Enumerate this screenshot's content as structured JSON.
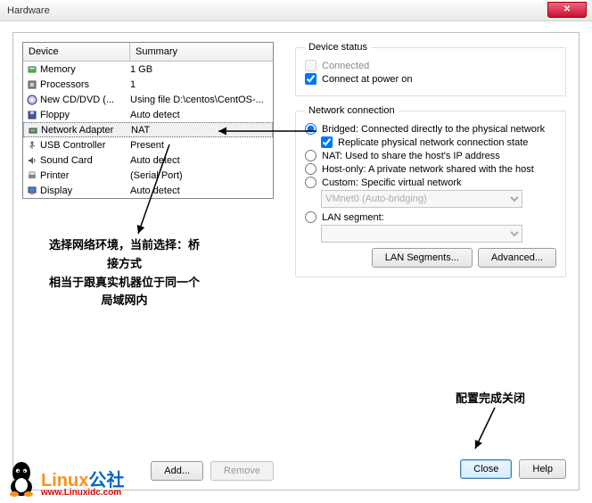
{
  "window": {
    "title": "Hardware"
  },
  "table": {
    "headers": {
      "device": "Device",
      "summary": "Summary"
    },
    "rows": [
      {
        "icon": "memory",
        "device": "Memory",
        "summary": "1 GB"
      },
      {
        "icon": "cpu",
        "device": "Processors",
        "summary": "1"
      },
      {
        "icon": "cd",
        "device": "New CD/DVD (...",
        "summary": "Using file D:\\centos\\CentOS-..."
      },
      {
        "icon": "floppy",
        "device": "Floppy",
        "summary": "Auto detect"
      },
      {
        "icon": "net",
        "device": "Network Adapter",
        "summary": "NAT",
        "selected": true
      },
      {
        "icon": "usb",
        "device": "USB Controller",
        "summary": "Present"
      },
      {
        "icon": "sound",
        "device": "Sound Card",
        "summary": "Auto detect"
      },
      {
        "icon": "printer",
        "device": "Printer",
        "summary": "(Serial Port)"
      },
      {
        "icon": "display",
        "device": "Display",
        "summary": "Auto detect"
      }
    ]
  },
  "buttons": {
    "add": "Add...",
    "remove": "Remove",
    "lan_segments": "LAN Segments...",
    "advanced": "Advanced...",
    "close": "Close",
    "help": "Help"
  },
  "device_status": {
    "legend": "Device status",
    "connected": "Connected",
    "connect_power": "Connect at power on"
  },
  "netconn": {
    "legend": "Network connection",
    "bridged": "Bridged: Connected directly to the physical network",
    "replicate": "Replicate physical network connection state",
    "nat": "NAT: Used to share the host's IP address",
    "hostonly": "Host-only: A private network shared with the host",
    "custom": "Custom: Specific virtual network",
    "custom_value": "VMnet0 (Auto-bridging)",
    "lanseg": "LAN segment:"
  },
  "annotations": {
    "left_line1": "选择网络环境，当前选择：桥",
    "left_line2": "接方式",
    "left_line3": "相当于跟真实机器位于同一个",
    "left_line4": "局域网内",
    "right": "配置完成关闭"
  },
  "watermark": {
    "brand_orange": "Linux",
    "brand_blue": "公社",
    "url": "www.Linuxidc.com"
  }
}
